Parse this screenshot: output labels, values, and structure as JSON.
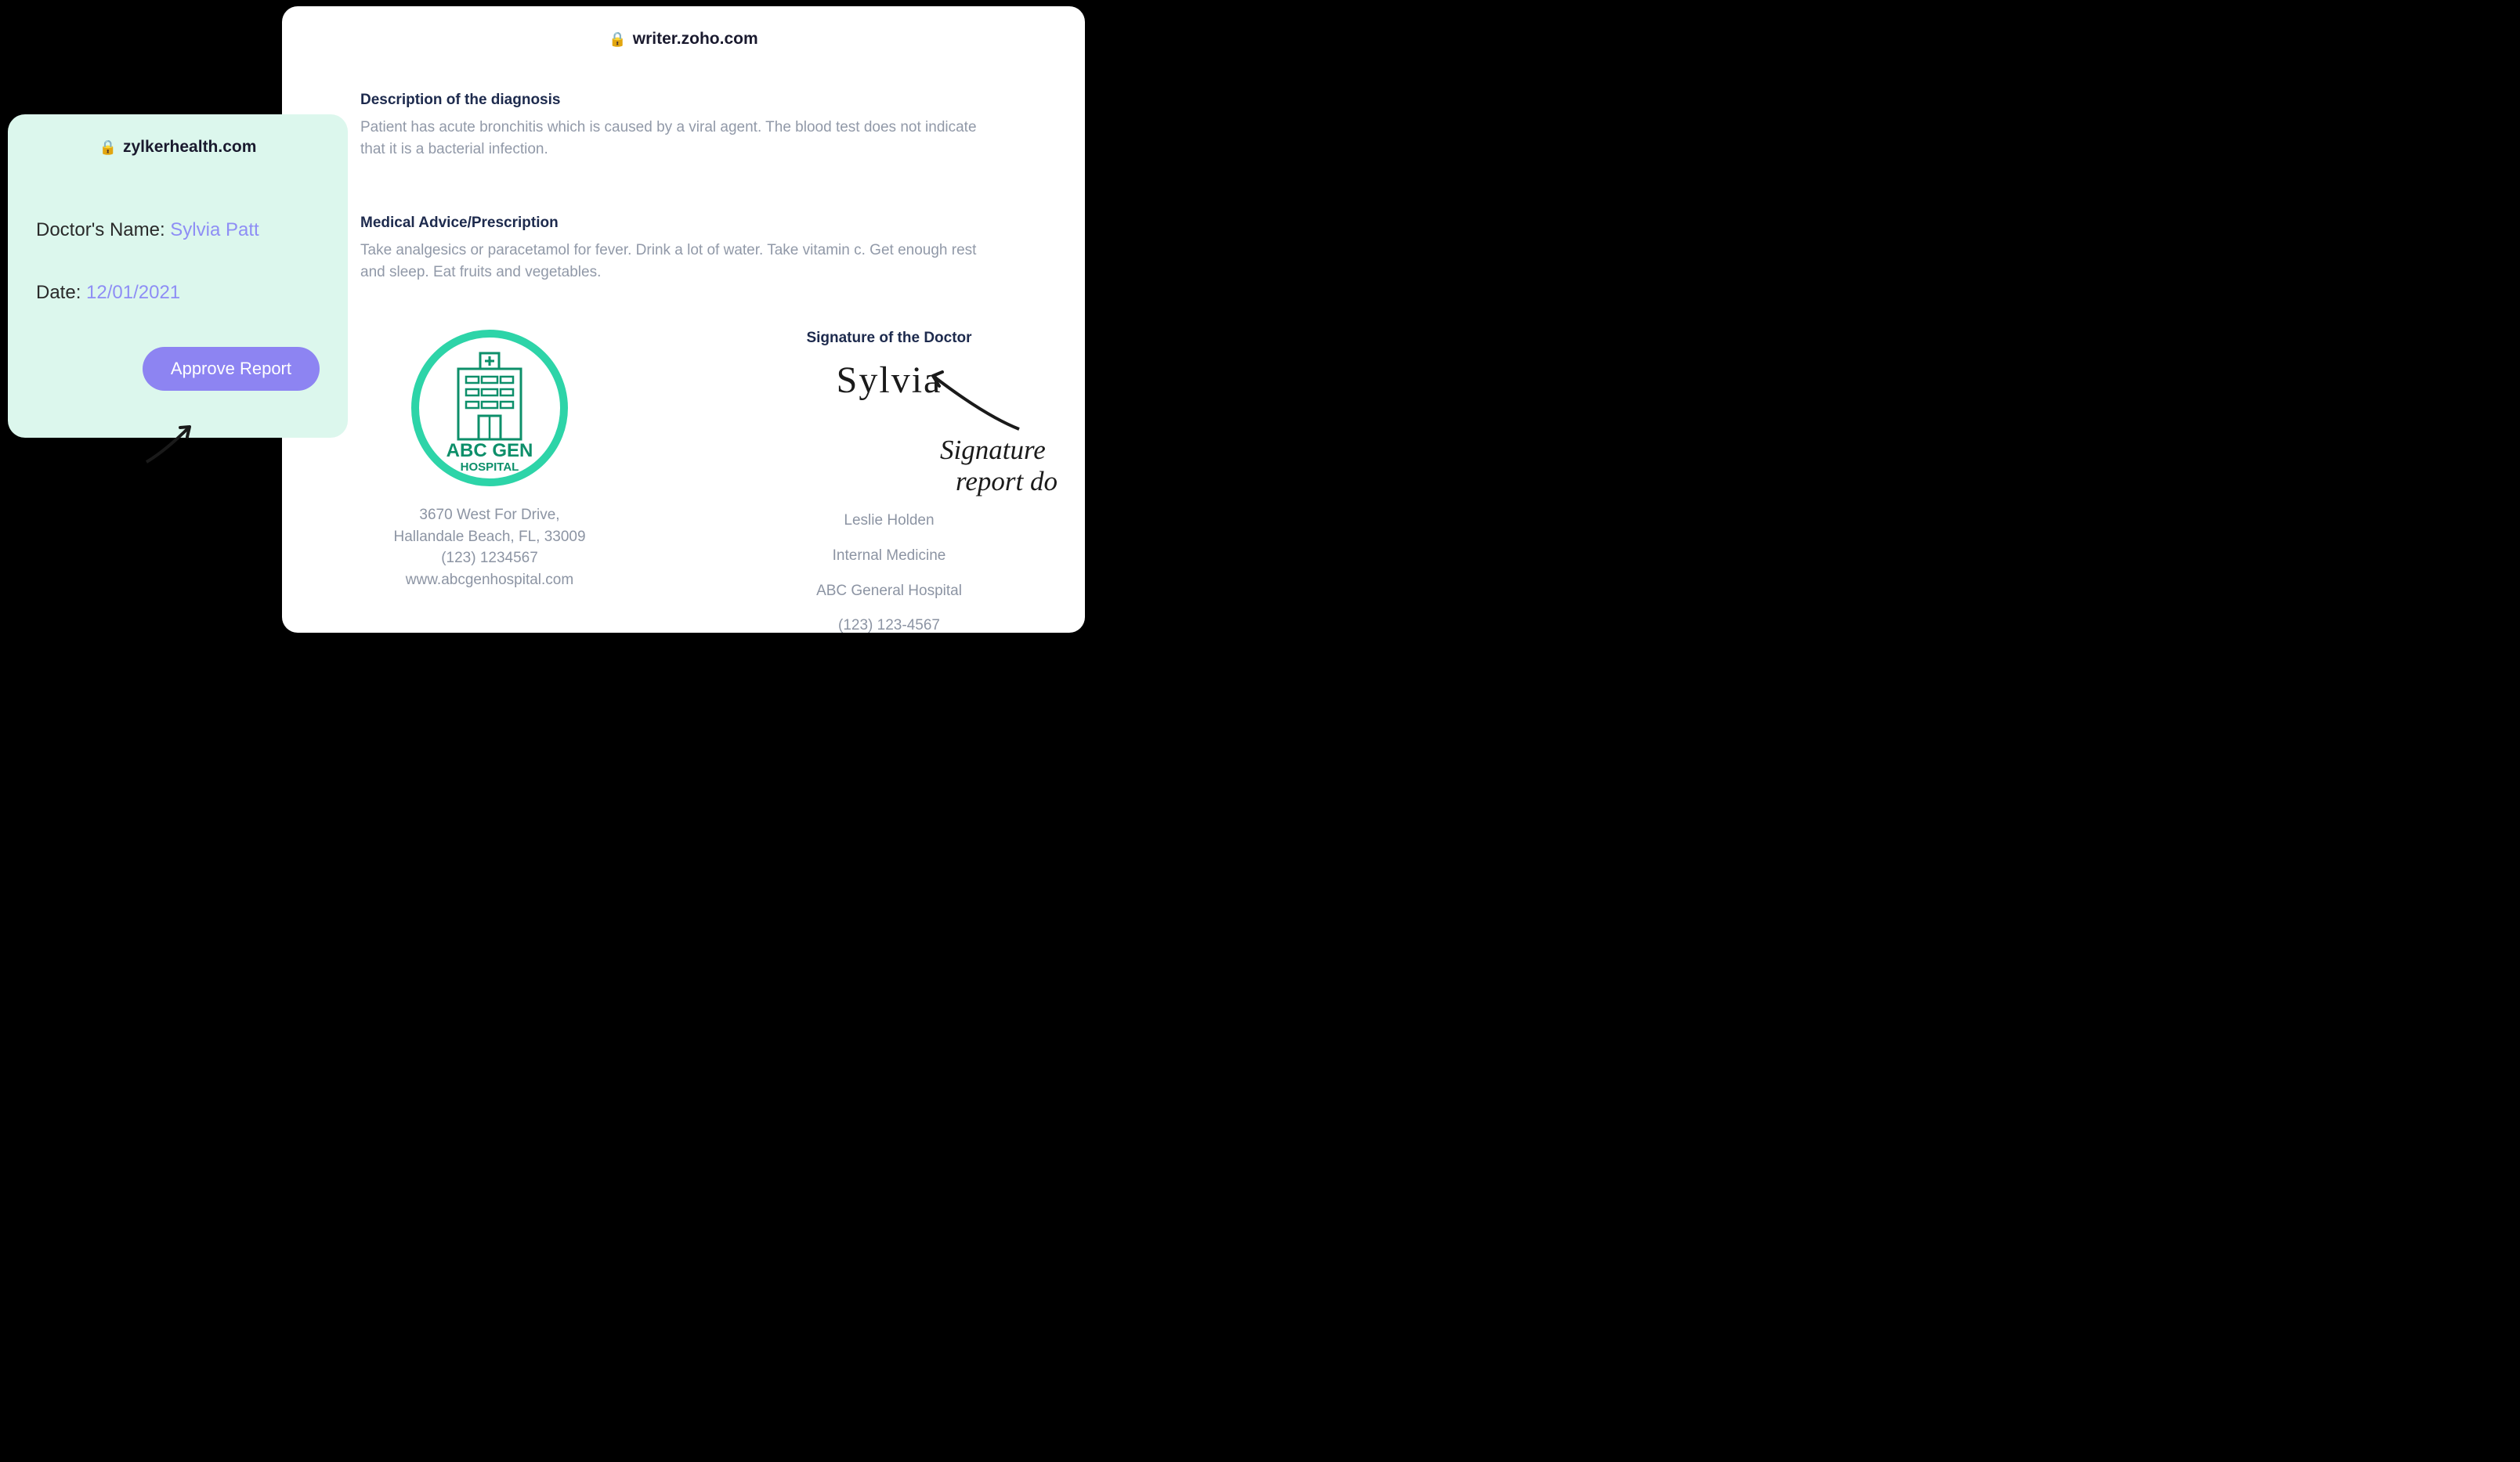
{
  "writer": {
    "domain": "writer.zoho.com",
    "diagnosis_title": "Description of the diagnosis",
    "diagnosis_body": "Patient has acute bronchitis which is caused by a viral agent. The blood test does not indicate that it is a bacterial infection.",
    "advice_title": "Medical Advice/Prescription",
    "advice_body": "Take analgesics or paracetamol for fever. Drink a lot of water. Take vitamin c. Get enough rest and sleep. Eat fruits and vegetables.",
    "hospital": {
      "logo_name": "ABC GEN",
      "logo_sub": "HOSPITAL",
      "address1": "3670 West For Drive,",
      "address2": "Hallandale Beach, FL, 33009",
      "phone": "(123) 1234567",
      "website": "www.abcgenhospital.com"
    },
    "signature": {
      "title": "Signature of the Doctor",
      "script": "Sylvia",
      "doctor_name": "Leslie Holden",
      "specialty": "Internal Medicine",
      "hospital_name": "ABC General Hospital",
      "phone": "(123) 123-4567"
    }
  },
  "zylker": {
    "domain": "zylkerhealth.com",
    "doctor_label": "Doctor's Name: ",
    "doctor_value": "Sylvia Patt",
    "date_label": "Date: ",
    "date_value": "12/01/2021",
    "approve_label": "Approve Report"
  },
  "annotations": {
    "sig_caption_l1": "Signature ",
    "sig_caption_l2": "report do"
  }
}
